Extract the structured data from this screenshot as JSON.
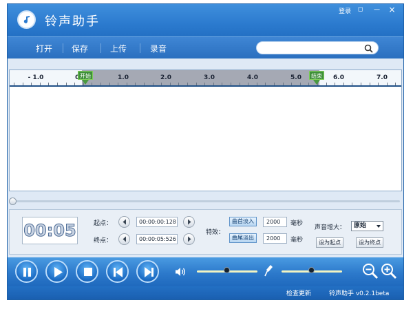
{
  "window": {
    "title": "铃声助手",
    "login_label": "登录",
    "controls": {
      "restore_glyph": "◻",
      "minimize_glyph": "—",
      "close_glyph": "×"
    }
  },
  "menu": {
    "items": [
      {
        "label": "打开"
      },
      {
        "label": "保存"
      },
      {
        "label": "上传"
      },
      {
        "label": "录音"
      }
    ],
    "search": {
      "value": "",
      "placeholder": ""
    }
  },
  "timeline": {
    "ticks": [
      {
        "label": "- 1.0"
      },
      {
        "label": "0."
      },
      {
        "label": "1.0"
      },
      {
        "label": "2.0"
      },
      {
        "label": "3.0"
      },
      {
        "label": "4.0"
      },
      {
        "label": "5.0"
      },
      {
        "label": "6.0"
      },
      {
        "label": "7.0"
      }
    ],
    "start_marker": "开始",
    "end_marker": "结束"
  },
  "controls": {
    "timer": "00:05",
    "start_label": "起点：",
    "end_label": "终点：",
    "start_time": "00:00:00:128",
    "end_time": "00:00:05:526",
    "effect_label": "特效：",
    "fade_in_label": "曲首淡入",
    "fade_out_label": "曲尾淡出",
    "fade_in_ms": "2000",
    "fade_out_ms": "2000",
    "ms_unit": "毫秒",
    "boost_label": "声音增大：",
    "boost_value": "原始",
    "set_start_label": "设为起点",
    "set_end_label": "设为终点"
  },
  "playback": {
    "volume_level": 0.5,
    "mic_level": 0.5
  },
  "status": {
    "check_update": "检查更新",
    "version": "铃声助手 v0.2.1beta"
  },
  "colors": {
    "title_bar": "#2c7bcf",
    "accent": "#1f69bd",
    "marker": "#3f8f3a"
  }
}
